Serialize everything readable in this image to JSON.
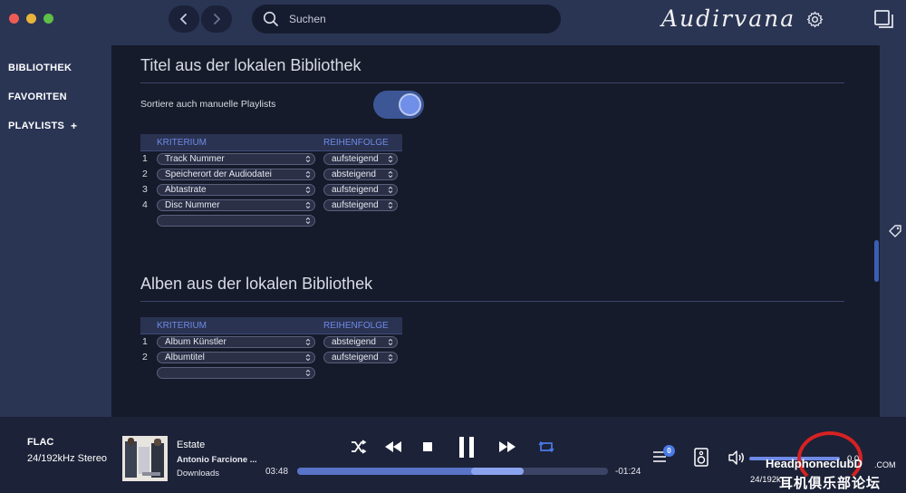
{
  "app": {
    "logo_text": "Audirvana"
  },
  "search": {
    "placeholder": "Suchen"
  },
  "sidebar": {
    "items": [
      {
        "label": "BIBLIOTHEK"
      },
      {
        "label": "FAVORITEN"
      },
      {
        "label": "PLAYLISTS"
      }
    ],
    "add_symbol": "+"
  },
  "tracks_section": {
    "title": "Titel aus der lokalen Bibliothek",
    "toggle_label": "Sortiere auch manuelle Playlists",
    "toggle_on": true,
    "header_criterion": "KRITERIUM",
    "header_order": "REIHENFOLGE",
    "rows": [
      {
        "num": "1",
        "criterion": "Track Nummer",
        "order": "aufsteigend"
      },
      {
        "num": "2",
        "criterion": "Speicherort der Audiodatei",
        "order": "absteigend"
      },
      {
        "num": "3",
        "criterion": "Abtastrate",
        "order": "aufsteigend"
      },
      {
        "num": "4",
        "criterion": "Disc Nummer",
        "order": "aufsteigend"
      }
    ]
  },
  "albums_section": {
    "title": "Alben aus der lokalen Bibliothek",
    "header_criterion": "KRITERIUM",
    "header_order": "REIHENFOLGE",
    "rows": [
      {
        "num": "1",
        "criterion": "Album Künstler",
        "order": "absteigend"
      },
      {
        "num": "2",
        "criterion": "Albumtitel",
        "order": "aufsteigend"
      }
    ]
  },
  "player": {
    "format": "FLAC",
    "format_detail": "24/192kHz Stereo",
    "title": "Estate",
    "artist": "Antonio Farcione ...",
    "album": "Downloads",
    "elapsed": "03:48",
    "remaining": "-01:24",
    "progress": 0.73,
    "queue_count": "0",
    "bitrate": "24/192k",
    "volume_text": "0.0"
  },
  "watermark": {
    "text": "HeadphoneclubD",
    "domain": ".COM",
    "cn": "耳机俱乐部论坛"
  },
  "colors": {
    "accent": "#4a7be8",
    "topbar": "#2a3554",
    "background": "#161b2b",
    "header_text": "#6f8ae6"
  }
}
